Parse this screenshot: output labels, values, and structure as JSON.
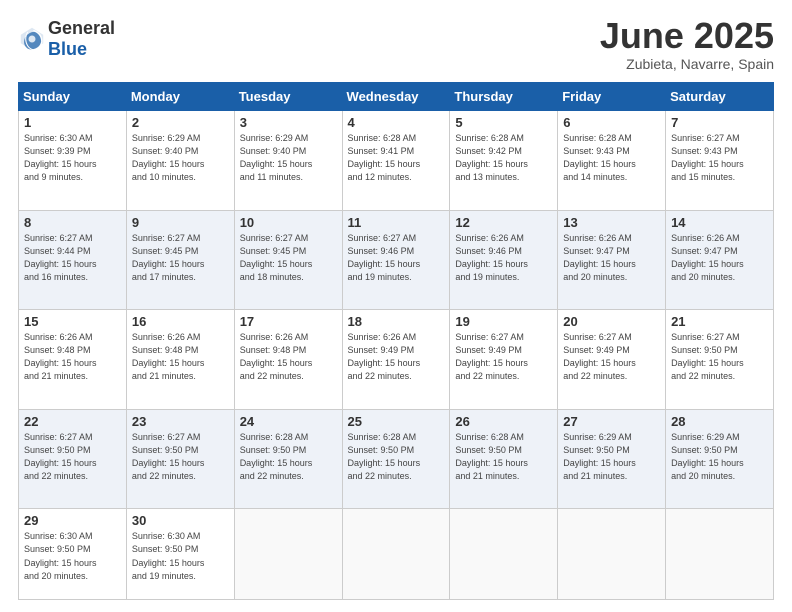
{
  "header": {
    "logo_general": "General",
    "logo_blue": "Blue",
    "month_title": "June 2025",
    "location": "Zubieta, Navarre, Spain"
  },
  "days_of_week": [
    "Sunday",
    "Monday",
    "Tuesday",
    "Wednesday",
    "Thursday",
    "Friday",
    "Saturday"
  ],
  "weeks": [
    [
      {
        "num": "1",
        "info": "Sunrise: 6:30 AM\nSunset: 9:39 PM\nDaylight: 15 hours\nand 9 minutes."
      },
      {
        "num": "2",
        "info": "Sunrise: 6:29 AM\nSunset: 9:40 PM\nDaylight: 15 hours\nand 10 minutes."
      },
      {
        "num": "3",
        "info": "Sunrise: 6:29 AM\nSunset: 9:40 PM\nDaylight: 15 hours\nand 11 minutes."
      },
      {
        "num": "4",
        "info": "Sunrise: 6:28 AM\nSunset: 9:41 PM\nDaylight: 15 hours\nand 12 minutes."
      },
      {
        "num": "5",
        "info": "Sunrise: 6:28 AM\nSunset: 9:42 PM\nDaylight: 15 hours\nand 13 minutes."
      },
      {
        "num": "6",
        "info": "Sunrise: 6:28 AM\nSunset: 9:43 PM\nDaylight: 15 hours\nand 14 minutes."
      },
      {
        "num": "7",
        "info": "Sunrise: 6:27 AM\nSunset: 9:43 PM\nDaylight: 15 hours\nand 15 minutes."
      }
    ],
    [
      {
        "num": "8",
        "info": "Sunrise: 6:27 AM\nSunset: 9:44 PM\nDaylight: 15 hours\nand 16 minutes."
      },
      {
        "num": "9",
        "info": "Sunrise: 6:27 AM\nSunset: 9:45 PM\nDaylight: 15 hours\nand 17 minutes."
      },
      {
        "num": "10",
        "info": "Sunrise: 6:27 AM\nSunset: 9:45 PM\nDaylight: 15 hours\nand 18 minutes."
      },
      {
        "num": "11",
        "info": "Sunrise: 6:27 AM\nSunset: 9:46 PM\nDaylight: 15 hours\nand 19 minutes."
      },
      {
        "num": "12",
        "info": "Sunrise: 6:26 AM\nSunset: 9:46 PM\nDaylight: 15 hours\nand 19 minutes."
      },
      {
        "num": "13",
        "info": "Sunrise: 6:26 AM\nSunset: 9:47 PM\nDaylight: 15 hours\nand 20 minutes."
      },
      {
        "num": "14",
        "info": "Sunrise: 6:26 AM\nSunset: 9:47 PM\nDaylight: 15 hours\nand 20 minutes."
      }
    ],
    [
      {
        "num": "15",
        "info": "Sunrise: 6:26 AM\nSunset: 9:48 PM\nDaylight: 15 hours\nand 21 minutes."
      },
      {
        "num": "16",
        "info": "Sunrise: 6:26 AM\nSunset: 9:48 PM\nDaylight: 15 hours\nand 21 minutes."
      },
      {
        "num": "17",
        "info": "Sunrise: 6:26 AM\nSunset: 9:48 PM\nDaylight: 15 hours\nand 22 minutes."
      },
      {
        "num": "18",
        "info": "Sunrise: 6:26 AM\nSunset: 9:49 PM\nDaylight: 15 hours\nand 22 minutes."
      },
      {
        "num": "19",
        "info": "Sunrise: 6:27 AM\nSunset: 9:49 PM\nDaylight: 15 hours\nand 22 minutes."
      },
      {
        "num": "20",
        "info": "Sunrise: 6:27 AM\nSunset: 9:49 PM\nDaylight: 15 hours\nand 22 minutes."
      },
      {
        "num": "21",
        "info": "Sunrise: 6:27 AM\nSunset: 9:50 PM\nDaylight: 15 hours\nand 22 minutes."
      }
    ],
    [
      {
        "num": "22",
        "info": "Sunrise: 6:27 AM\nSunset: 9:50 PM\nDaylight: 15 hours\nand 22 minutes."
      },
      {
        "num": "23",
        "info": "Sunrise: 6:27 AM\nSunset: 9:50 PM\nDaylight: 15 hours\nand 22 minutes."
      },
      {
        "num": "24",
        "info": "Sunrise: 6:28 AM\nSunset: 9:50 PM\nDaylight: 15 hours\nand 22 minutes."
      },
      {
        "num": "25",
        "info": "Sunrise: 6:28 AM\nSunset: 9:50 PM\nDaylight: 15 hours\nand 22 minutes."
      },
      {
        "num": "26",
        "info": "Sunrise: 6:28 AM\nSunset: 9:50 PM\nDaylight: 15 hours\nand 21 minutes."
      },
      {
        "num": "27",
        "info": "Sunrise: 6:29 AM\nSunset: 9:50 PM\nDaylight: 15 hours\nand 21 minutes."
      },
      {
        "num": "28",
        "info": "Sunrise: 6:29 AM\nSunset: 9:50 PM\nDaylight: 15 hours\nand 20 minutes."
      }
    ],
    [
      {
        "num": "29",
        "info": "Sunrise: 6:30 AM\nSunset: 9:50 PM\nDaylight: 15 hours\nand 20 minutes."
      },
      {
        "num": "30",
        "info": "Sunrise: 6:30 AM\nSunset: 9:50 PM\nDaylight: 15 hours\nand 19 minutes."
      },
      {
        "num": "",
        "info": ""
      },
      {
        "num": "",
        "info": ""
      },
      {
        "num": "",
        "info": ""
      },
      {
        "num": "",
        "info": ""
      },
      {
        "num": "",
        "info": ""
      }
    ]
  ]
}
